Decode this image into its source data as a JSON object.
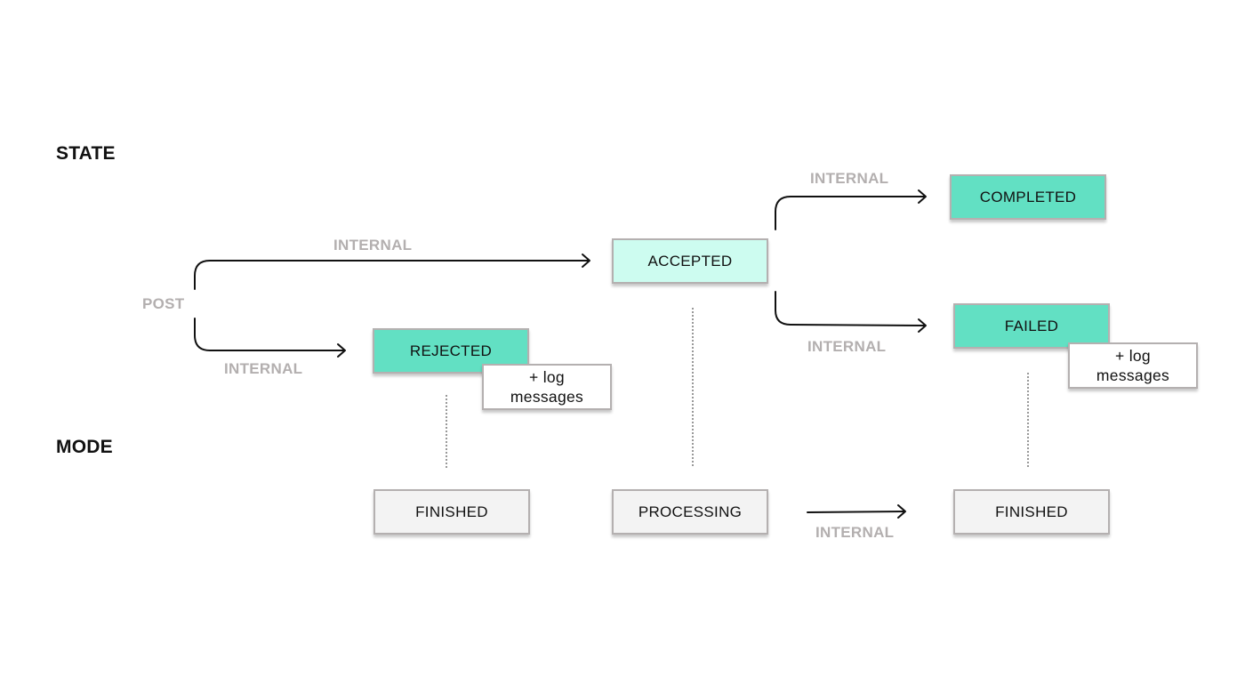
{
  "sections": {
    "state": "STATE",
    "mode": "MODE"
  },
  "colors": {
    "final_state": "#62e0c3",
    "intermediate_state": "#cdfcf0",
    "mode_box": "#f3f3f3",
    "edge_label": "#b3afaf"
  },
  "labels": {
    "post": "POST",
    "to_accepted": "INTERNAL",
    "to_rejected": "INTERNAL",
    "to_completed": "INTERNAL",
    "to_failed": "INTERNAL",
    "mode_transition": "INTERNAL"
  },
  "states": {
    "accepted": "ACCEPTED",
    "rejected": "REJECTED",
    "completed": "COMPLETED",
    "failed": "FAILED"
  },
  "notes": {
    "rejected": [
      "+ log",
      "messages"
    ],
    "failed": [
      "+ log",
      "messages"
    ]
  },
  "modes": {
    "rejected_mode": "FINISHED",
    "accepted_mode": "PROCESSING",
    "failed_mode": "FINISHED"
  }
}
